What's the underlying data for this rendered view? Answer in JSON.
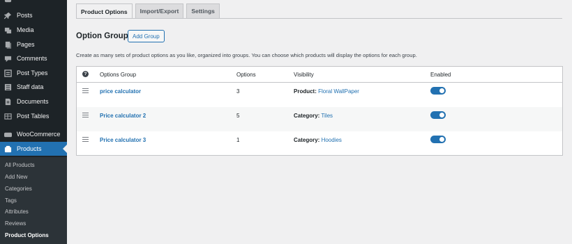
{
  "sidebar": {
    "items": [
      {
        "label": "",
        "icon": "dashboard-icon"
      },
      {
        "label": "Posts",
        "icon": "pin-icon"
      },
      {
        "label": "Media",
        "icon": "media-icon"
      },
      {
        "label": "Pages",
        "icon": "page-icon"
      },
      {
        "label": "Comments",
        "icon": "comment-icon"
      },
      {
        "label": "Post Types",
        "icon": "post-types-icon"
      },
      {
        "label": "Staff data",
        "icon": "staff-data-icon"
      },
      {
        "label": "Documents",
        "icon": "documents-icon"
      },
      {
        "label": "Post Tables",
        "icon": "table-icon"
      },
      {
        "label": "WooCommerce",
        "icon": "woocommerce-icon"
      },
      {
        "label": "Products",
        "icon": "products-icon"
      }
    ],
    "submenu": [
      "All Products",
      "Add New",
      "Categories",
      "Tags",
      "Attributes",
      "Reviews",
      "Product Options"
    ]
  },
  "tabs": [
    "Product Options",
    "Import/Export",
    "Settings"
  ],
  "heading": "Option Groups",
  "add_group_label": "Add Group",
  "description": "Create as many sets of product options as you like, organized into groups. You can choose which products will display the options for each group.",
  "table": {
    "headers": {
      "help": "?",
      "group": "Options Group",
      "options": "Options",
      "visibility": "Visibility",
      "enabled": "Enabled"
    },
    "rows": [
      {
        "name": "price calculator",
        "options": "3",
        "vis_label": "Product:",
        "vis_value": "Floral WallPaper",
        "enabled": true
      },
      {
        "name": "Price calculator 2",
        "options": "5",
        "vis_label": "Category:",
        "vis_value": "Tiles",
        "enabled": true
      },
      {
        "name": "Price calculator 3",
        "options": "1",
        "vis_label": "Category:",
        "vis_value": "Hoodies",
        "enabled": true
      }
    ]
  },
  "colors": {
    "accent": "#2271b1",
    "sidebar": "#1d2327",
    "submenu": "#2c3338",
    "background": "#f0f0f1"
  }
}
